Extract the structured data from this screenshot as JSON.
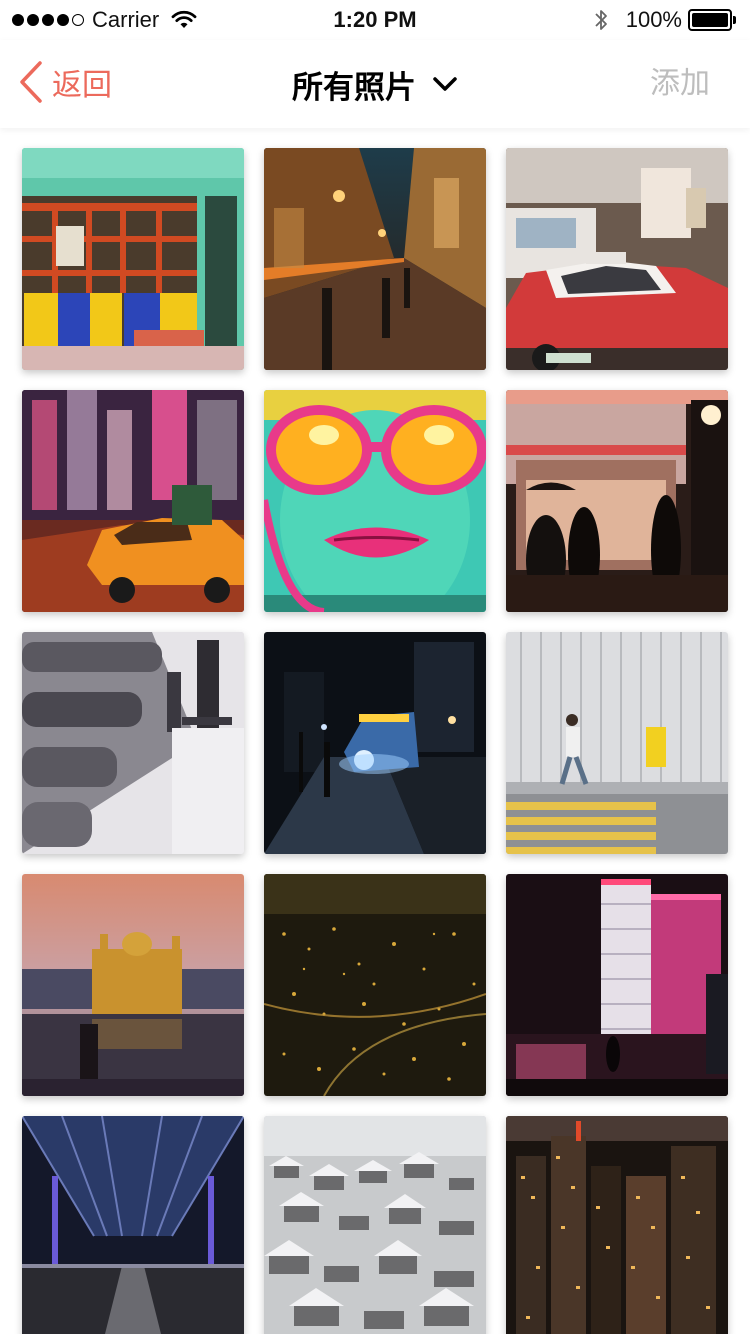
{
  "status_bar": {
    "carrier": "Carrier",
    "time": "1:20 PM",
    "battery": "100%",
    "signal_bars_filled": 4,
    "signal_bars_total": 5
  },
  "nav": {
    "back_label": "返回",
    "title": "所有照片",
    "add_label": "添加"
  },
  "colors": {
    "accent": "#ec6a5c",
    "disabled": "#bdbdbd"
  },
  "photos": [
    {
      "scene": "teal-storefront"
    },
    {
      "scene": "night-alley-street"
    },
    {
      "scene": "red-taxi-street"
    },
    {
      "scene": "neon-city-taxi"
    },
    {
      "scene": "graffiti-face-sunglasses"
    },
    {
      "scene": "noodle-bar-night"
    },
    {
      "scene": "snowy-fence-posts"
    },
    {
      "scene": "night-bus-street"
    },
    {
      "scene": "pedestrian-crosswalk"
    },
    {
      "scene": "golden-temple-dusk"
    },
    {
      "scene": "aerial-city-lights"
    },
    {
      "scene": "neon-skyscraper-rain"
    },
    {
      "scene": "glass-atrium-hall"
    },
    {
      "scene": "snowy-village-aerial"
    },
    {
      "scene": "city-skyline-night"
    }
  ]
}
